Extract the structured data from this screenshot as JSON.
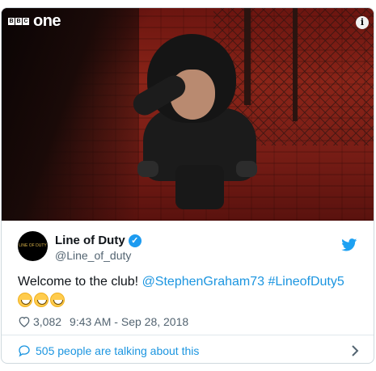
{
  "media": {
    "channel_brand": "one",
    "bbc_letters": [
      "B",
      "B",
      "C"
    ],
    "info_glyph": "i"
  },
  "tweet": {
    "avatar_text": "LINE OF DUTY",
    "name": "Line of Duty",
    "verified_glyph": "✓",
    "handle": "@Line_of_duty",
    "text_prefix": "Welcome to the club! ",
    "mention": "@StephenGraham73",
    "hashtag": "#LineofDuty5",
    "emoji_count": 3,
    "likes": "3,082",
    "timestamp": "9:43 AM - Sep 28, 2018",
    "talking": "505 people are talking about this"
  },
  "colors": {
    "link": "#1b95e0",
    "verified": "#1d9bf0",
    "twitter_blue": "#1da1f2"
  },
  "icons": [
    "bbc-one-logo",
    "info-icon",
    "verified-icon",
    "twitter-bird-icon",
    "heart-icon",
    "comment-icon",
    "chevron-right-icon"
  ]
}
